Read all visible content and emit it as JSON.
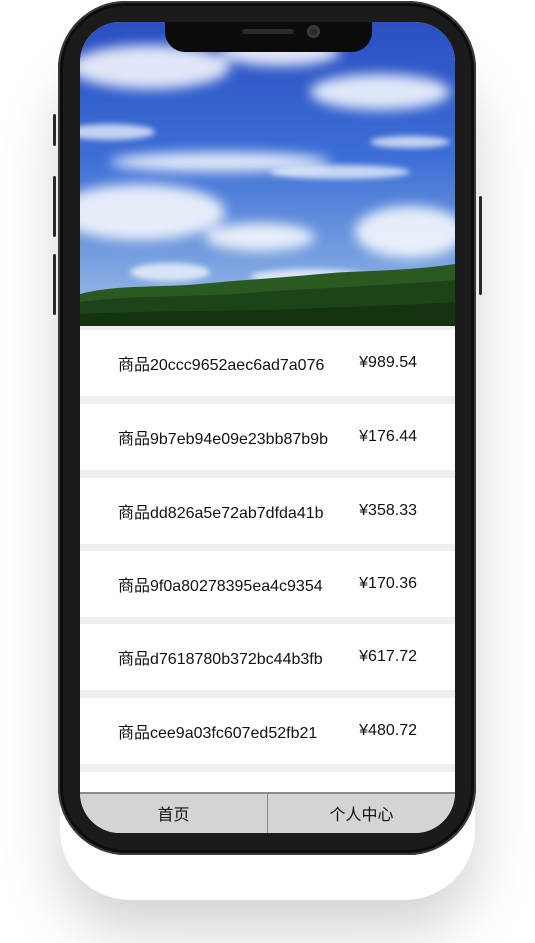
{
  "products": [
    {
      "name": "商品20ccc9652aec6ad7a076",
      "price": "¥989.54"
    },
    {
      "name": "商品9b7eb94e09e23bb87b9b",
      "price": "¥176.44"
    },
    {
      "name": "商品dd826a5e72ab7dfda41b",
      "price": "¥358.33"
    },
    {
      "name": "商品9f0a80278395ea4c9354",
      "price": "¥170.36"
    },
    {
      "name": "商品d7618780b372bc44b3fb",
      "price": "¥617.72"
    },
    {
      "name": "商品cee9a03fc607ed52fb21",
      "price": "¥480.72"
    },
    {
      "name": "",
      "price": ""
    }
  ],
  "tabbar": {
    "home_label": "首页",
    "profile_label": "个人中心"
  },
  "colors": {
    "sky_top": "#2f56c8",
    "sky_bottom": "#8fb4e6",
    "forest": "#1e4a1c",
    "tabbar_bg": "#d4d4d4",
    "list_bg": "#efefef"
  }
}
